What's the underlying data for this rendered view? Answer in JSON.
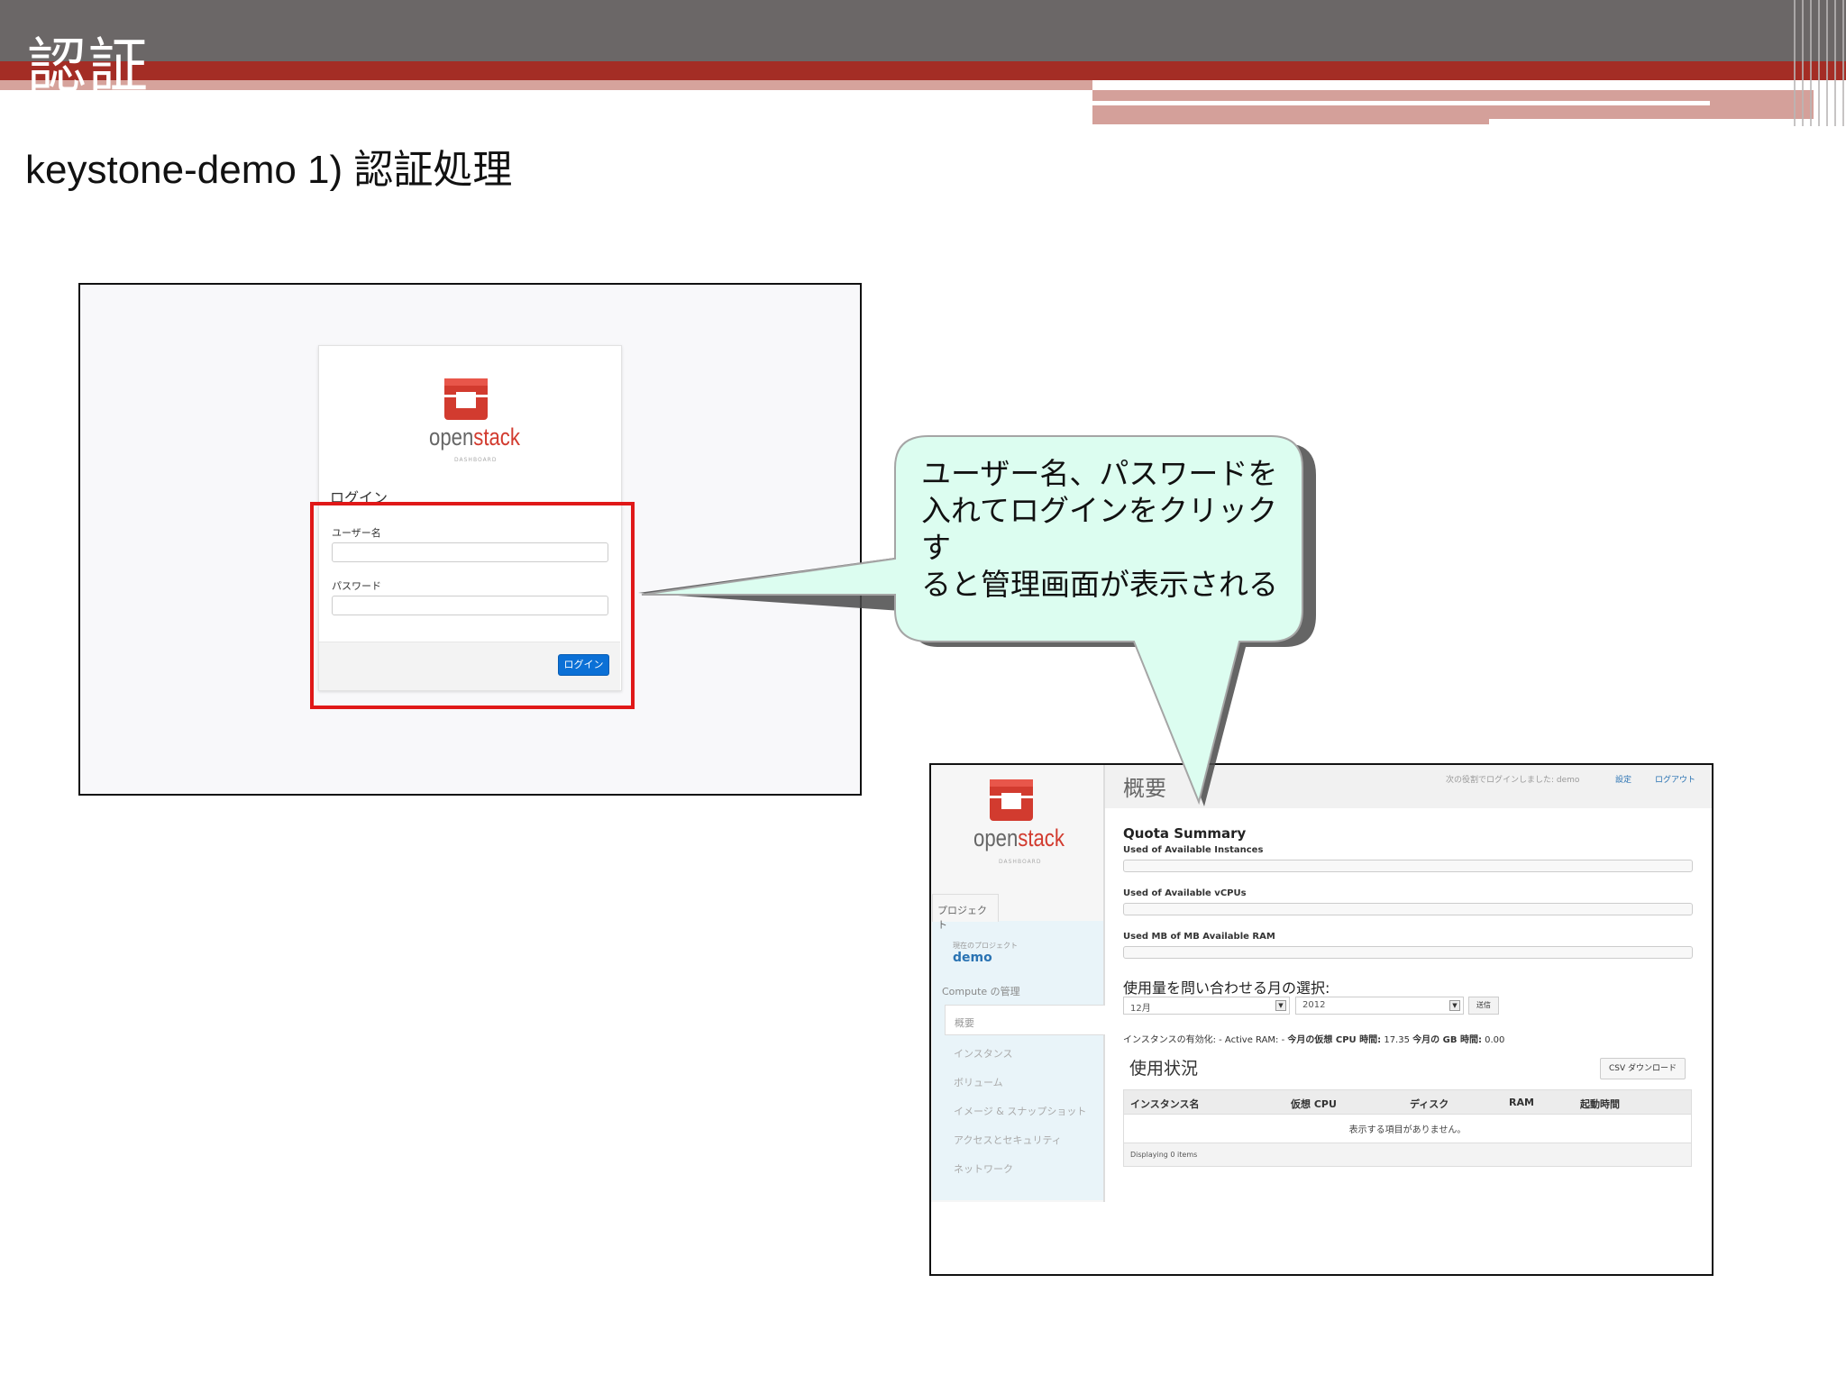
{
  "slide": {
    "title": "認証",
    "subtitle": "keystone-demo 1) 認証処理"
  },
  "login": {
    "logo_open": "open",
    "logo_stack": "stack",
    "logo_sub": "DASHBOARD",
    "heading": "ログイン",
    "username_label": "ユーザー名",
    "username_value": "",
    "password_label": "パスワード",
    "password_value": "",
    "login_button": "ログイン"
  },
  "callout": {
    "lines": [
      "ユーザー名、パスワードを",
      "入れてログインをクリックす",
      "ると管理画面が表示される"
    ],
    "fill": "#dcfdf0"
  },
  "dashboard": {
    "logo_open": "open",
    "logo_stack": "stack",
    "logo_sub": "DASHBOARD",
    "sidebar": {
      "project_tab": "プロジェクト",
      "current_project_label": "現在のプロジェクト",
      "current_project": "demo",
      "section": "Compute の管理",
      "active_item": "概要",
      "items": [
        "インスタンス",
        "ボリューム",
        "イメージ & スナップショット",
        "アクセスとセキュリティ",
        "ネットワーク"
      ]
    },
    "title": "概要",
    "topbar": {
      "logged_in": "次の役割でログインしました: demo",
      "settings": "設定",
      "logout": "ログアウト"
    },
    "quota": {
      "heading": "Quota Summary",
      "labels": [
        "Used of Available Instances",
        "Used of Available vCPUs",
        "Used MB of MB Available RAM"
      ]
    },
    "query_label": "使用量を問い合わせる月の選択:",
    "month": "12月",
    "year": "2012",
    "send_button": "送信",
    "stats": {
      "p1": "インスタンスの有効化: -  Active RAM: -  ",
      "b1": "今月の仮想 CPU 時間:",
      "v1": " 17.35 ",
      "b2": "今月の GB 時間:",
      "v2": " 0.00"
    },
    "usage_heading": "使用状況",
    "csv_button": "CSV ダウンロード",
    "table": {
      "columns": [
        "インスタンス名",
        "仮想 CPU",
        "ディスク",
        "RAM",
        "起動時間"
      ],
      "empty": "表示する項目がありません。",
      "footer": "Displaying 0 items"
    }
  },
  "colors": {
    "header_gray": "#6b6767",
    "header_red": "#a42d25",
    "highlight_red": "#e01818",
    "openstack_red": "#d23b2f",
    "login_button": "#0b70d6"
  }
}
